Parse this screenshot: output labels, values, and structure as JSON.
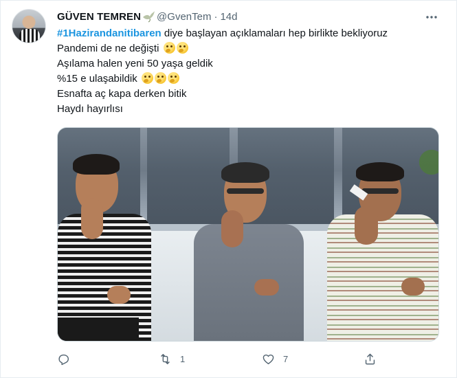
{
  "tweet": {
    "author": {
      "display_name": "GÜVEN TEMREN",
      "name_emoji": "dove-icon",
      "handle": "@GvenTem",
      "separator": "·",
      "timestamp": "14d"
    },
    "text": {
      "hashtag": "#1Hazirandanitibaren",
      "line1_rest": " diye başlayan açıklamaları hep birlikte bekliyoruz",
      "line2": "Pandemi de ne değişti",
      "line3": "Aşılama halen yeni 50 yaşa geldik",
      "line4": "%15 e ulaşabildik",
      "line5": "Esnafta aç kapa derken bitik",
      "line6": "Haydı hayırlısı"
    },
    "emojis": {
      "line2": [
        "thinking-face-icon",
        "thinking-face-icon"
      ],
      "line4": [
        "thinking-face-icon",
        "thinking-face-icon",
        "thinking-face-icon"
      ]
    },
    "media": {
      "description_icon": "photo-icon"
    },
    "actions": {
      "reply_count": "",
      "retweet_count": "1",
      "like_count": "7",
      "share_count": ""
    }
  },
  "colors": {
    "accent": "#1b95e0",
    "text": "#0f1419",
    "secondary": "#536471"
  }
}
